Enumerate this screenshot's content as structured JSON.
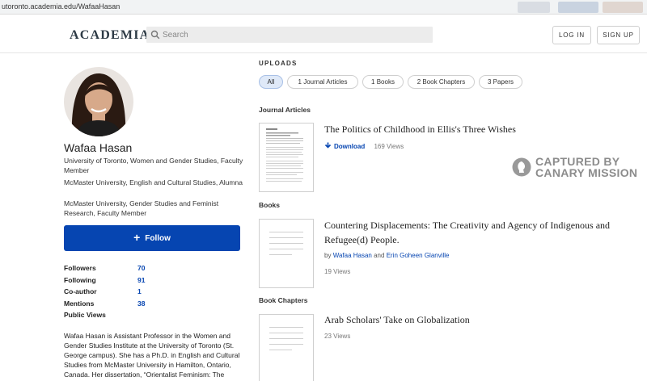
{
  "browser": {
    "url": "utoronto.academia.edu/WafaaHasan"
  },
  "nav": {
    "logo": "ACADEMIA",
    "search_placeholder": "Search",
    "login": "LOG IN",
    "signup": "SIGN UP"
  },
  "profile": {
    "name": "Wafaa Hasan",
    "affiliations": [
      "University of Toronto, Women and Gender Studies, Faculty Member",
      "McMaster University, English and Cultural Studies, Alumna",
      "McMaster University, Gender Studies and Feminist Research, Faculty Member"
    ],
    "follow_label": "Follow",
    "stats": [
      {
        "label": "Followers",
        "value": "70"
      },
      {
        "label": "Following",
        "value": "91"
      },
      {
        "label": "Co-author",
        "value": "1"
      },
      {
        "label": "Mentions",
        "value": "38"
      },
      {
        "label": "Public Views",
        "value": ""
      }
    ],
    "bio": "Wafaa Hasan is Assistant Professor in the Women and Gender Studies Institute at the University of Toronto (St. George campus). She has a Ph.D. in English and Cultural Studies from McMaster University in Hamilton, Ontario, Canada. Her dissertation, “Orientalist Feminism: The"
  },
  "uploads": {
    "title": "UPLOADS",
    "filters": [
      "All",
      "1 Journal Articles",
      "1 Books",
      "2 Book Chapters",
      "3 Papers"
    ],
    "active_filter": "All",
    "sections": {
      "journal": "Journal Articles",
      "books": "Books",
      "chapters": "Book Chapters"
    },
    "journal_item": {
      "title": "The Politics of Childhood in Ellis's Three Wishes",
      "download": "Download",
      "views": "169 Views"
    },
    "book_item": {
      "title_line1": "Countering Displacements: The Creativity and Agency of Indigenous and",
      "title_line2": "Refugee(d) People.",
      "by": "by",
      "author1": "Wafaa Hasan",
      "and": "and",
      "author2": "Erin Goheen Glanville",
      "views": "19 Views"
    },
    "chapter_item": {
      "title": "Arab Scholars' Take on Globalization",
      "views": "23 Views"
    }
  },
  "watermark": {
    "line1": "CAPTURED BY",
    "line2": "CANARY MISSION"
  },
  "colors": {
    "accent": "#0645b1",
    "chip_active": "#dfe9f8"
  }
}
